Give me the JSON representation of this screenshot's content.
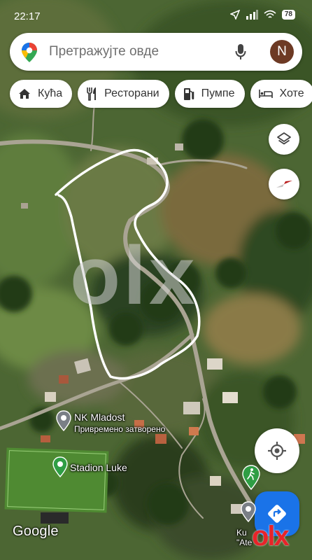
{
  "status_bar": {
    "time": "22:17",
    "battery": "78"
  },
  "search": {
    "placeholder": "Претражујте овде",
    "avatar_letter": "N"
  },
  "chips": [
    {
      "icon": "home-icon",
      "label": "Кућа"
    },
    {
      "icon": "restaurant-icon",
      "label": "Ресторани"
    },
    {
      "icon": "gas-station-icon",
      "label": "Пумпе"
    },
    {
      "icon": "hotel-icon",
      "label": "Хоте"
    }
  ],
  "map": {
    "labels": {
      "nk_name": "NK Mladost",
      "nk_status": "Привремено затворено",
      "stadion": "Stadion Luke",
      "partial_line1": "Ku",
      "partial_line2": "\"Ate"
    },
    "google_logo": "Google"
  },
  "watermarks": {
    "center": "olx",
    "corner": "olx"
  },
  "colors": {
    "accent": "#1a73e8",
    "poi_green": "#2f9e44",
    "poi_gray": "#7a7f86",
    "olx_red": "#e8242a"
  }
}
